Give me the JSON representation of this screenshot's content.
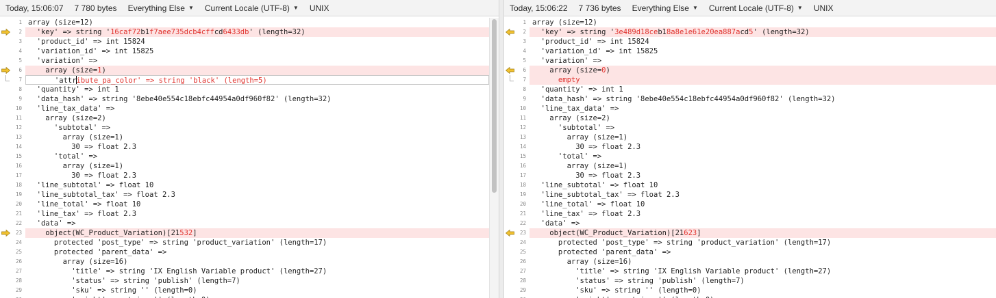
{
  "left": {
    "header": {
      "date": "Today, 15:06:07",
      "size": "7 780 bytes",
      "filter": "Everything Else",
      "encoding": "Current Locale (UTF-8)",
      "line_ending": "UNIX"
    },
    "lines": [
      [
        {
          "t": "array (size=12)"
        }
      ],
      [
        {
          "t": "  'key' => string '"
        },
        {
          "t": "16caf72",
          "d": 1
        },
        {
          "t": "b1"
        },
        {
          "t": "f7aee735dcb4cff",
          "d": 1
        },
        {
          "t": "cd"
        },
        {
          "t": "6433db",
          "d": 1
        },
        {
          "t": "' (length=32)"
        }
      ],
      [
        {
          "t": "  'product_id' => int 15824"
        }
      ],
      [
        {
          "t": "  'variation_id' => int 15825"
        }
      ],
      [
        {
          "t": "  'variation' =>"
        }
      ],
      [
        {
          "t": "    array (size="
        },
        {
          "t": "1",
          "d": 1
        },
        {
          "t": ")"
        }
      ],
      [
        {
          "t": "      'attr"
        },
        {
          "cursor": 1
        },
        {
          "t": "ibute_pa_color' => string 'black' (length=5)",
          "d": 1
        }
      ],
      [
        {
          "t": "  'quantity' => int 1"
        }
      ],
      [
        {
          "t": "  'data_hash' => string '8ebe40e554c18ebfc44954a0df960f82' (length=32)"
        }
      ],
      [
        {
          "t": "  'line_tax_data' =>"
        }
      ],
      [
        {
          "t": "    array (size=2)"
        }
      ],
      [
        {
          "t": "      'subtotal' =>"
        }
      ],
      [
        {
          "t": "        array (size=1)"
        }
      ],
      [
        {
          "t": "          30 => float 2.3"
        }
      ],
      [
        {
          "t": "      'total' =>"
        }
      ],
      [
        {
          "t": "        array (size=1)"
        }
      ],
      [
        {
          "t": "          30 => float 2.3"
        }
      ],
      [
        {
          "t": "  'line_subtotal' => float 10"
        }
      ],
      [
        {
          "t": "  'line_subtotal_tax' => float 2.3"
        }
      ],
      [
        {
          "t": "  'line_total' => float 10"
        }
      ],
      [
        {
          "t": "  'line_tax' => float 2.3"
        }
      ],
      [
        {
          "t": "  'data' =>"
        }
      ],
      [
        {
          "t": "    object(WC_Product_Variation)[21"
        },
        {
          "t": "532",
          "d": 1
        },
        {
          "t": "]"
        }
      ],
      [
        {
          "t": "      protected 'post_type' => string 'product_variation' (length=17)"
        }
      ],
      [
        {
          "t": "      protected 'parent_data' =>"
        }
      ],
      [
        {
          "t": "        array (size=16)"
        }
      ],
      [
        {
          "t": "          'title' => string 'IX English Variable product' (length=27)"
        }
      ],
      [
        {
          "t": "          'status' => string 'publish' (length=7)"
        }
      ],
      [
        {
          "t": "          'sku' => string '' (length=0)"
        }
      ],
      [
        {
          "t": "          'weight' => string '' (length=0)"
        }
      ]
    ]
  },
  "right": {
    "header": {
      "date": "Today, 15:06:22",
      "size": "7 736 bytes",
      "filter": "Everything Else",
      "encoding": "Current Locale (UTF-8)",
      "line_ending": "UNIX"
    },
    "lines": [
      [
        {
          "t": "array (size=12)"
        }
      ],
      [
        {
          "t": "  'key' => string '"
        },
        {
          "t": "3e489d18ce",
          "d": 1
        },
        {
          "t": "b1"
        },
        {
          "t": "8a8e1e61e20ea887a",
          "d": 1
        },
        {
          "t": "cd"
        },
        {
          "t": "5",
          "d": 1
        },
        {
          "t": "' (length=32)"
        }
      ],
      [
        {
          "t": "  'product_id' => int 15824"
        }
      ],
      [
        {
          "t": "  'variation_id' => int 15825"
        }
      ],
      [
        {
          "t": "  'variation' =>"
        }
      ],
      [
        {
          "t": "    array (size="
        },
        {
          "t": "0",
          "d": 1
        },
        {
          "t": ")"
        }
      ],
      [
        {
          "t": "      empty",
          "d": 1
        }
      ],
      [
        {
          "t": "  'quantity' => int 1"
        }
      ],
      [
        {
          "t": "  'data_hash' => string '8ebe40e554c18ebfc44954a0df960f82' (length=32)"
        }
      ],
      [
        {
          "t": "  'line_tax_data' =>"
        }
      ],
      [
        {
          "t": "    array (size=2)"
        }
      ],
      [
        {
          "t": "      'subtotal' =>"
        }
      ],
      [
        {
          "t": "        array (size=1)"
        }
      ],
      [
        {
          "t": "          30 => float 2.3"
        }
      ],
      [
        {
          "t": "      'total' =>"
        }
      ],
      [
        {
          "t": "        array (size=1)"
        }
      ],
      [
        {
          "t": "          30 => float 2.3"
        }
      ],
      [
        {
          "t": "  'line_subtotal' => float 10"
        }
      ],
      [
        {
          "t": "  'line_subtotal_tax' => float 2.3"
        }
      ],
      [
        {
          "t": "  'line_total' => float 10"
        }
      ],
      [
        {
          "t": "  'line_tax' => float 2.3"
        }
      ],
      [
        {
          "t": "  'data' =>"
        }
      ],
      [
        {
          "t": "    object(WC_Product_Variation)[21"
        },
        {
          "t": "623",
          "d": 1
        },
        {
          "t": "]"
        }
      ],
      [
        {
          "t": "      protected 'post_type' => string 'product_variation' (length=17)"
        }
      ],
      [
        {
          "t": "      protected 'parent_data' =>"
        }
      ],
      [
        {
          "t": "        array (size=16)"
        }
      ],
      [
        {
          "t": "          'title' => string 'IX English Variable product' (length=27)"
        }
      ],
      [
        {
          "t": "          'status' => string 'publish' (length=7)"
        }
      ],
      [
        {
          "t": "          'sku' => string '' (length=0)"
        }
      ],
      [
        {
          "t": "          'weight' => string '' (length=0)"
        }
      ]
    ]
  },
  "gutter": {
    "changed_lines": [
      2,
      6,
      7,
      23
    ],
    "arrow_lines": [
      2,
      6,
      23
    ],
    "bracket_lines": [
      7
    ],
    "arrow_icon": "arrow-icon",
    "arrow_color": "#f2c230"
  },
  "colors": {
    "diff_text": "#e0332e",
    "changed_bg": "#fde4e4"
  }
}
